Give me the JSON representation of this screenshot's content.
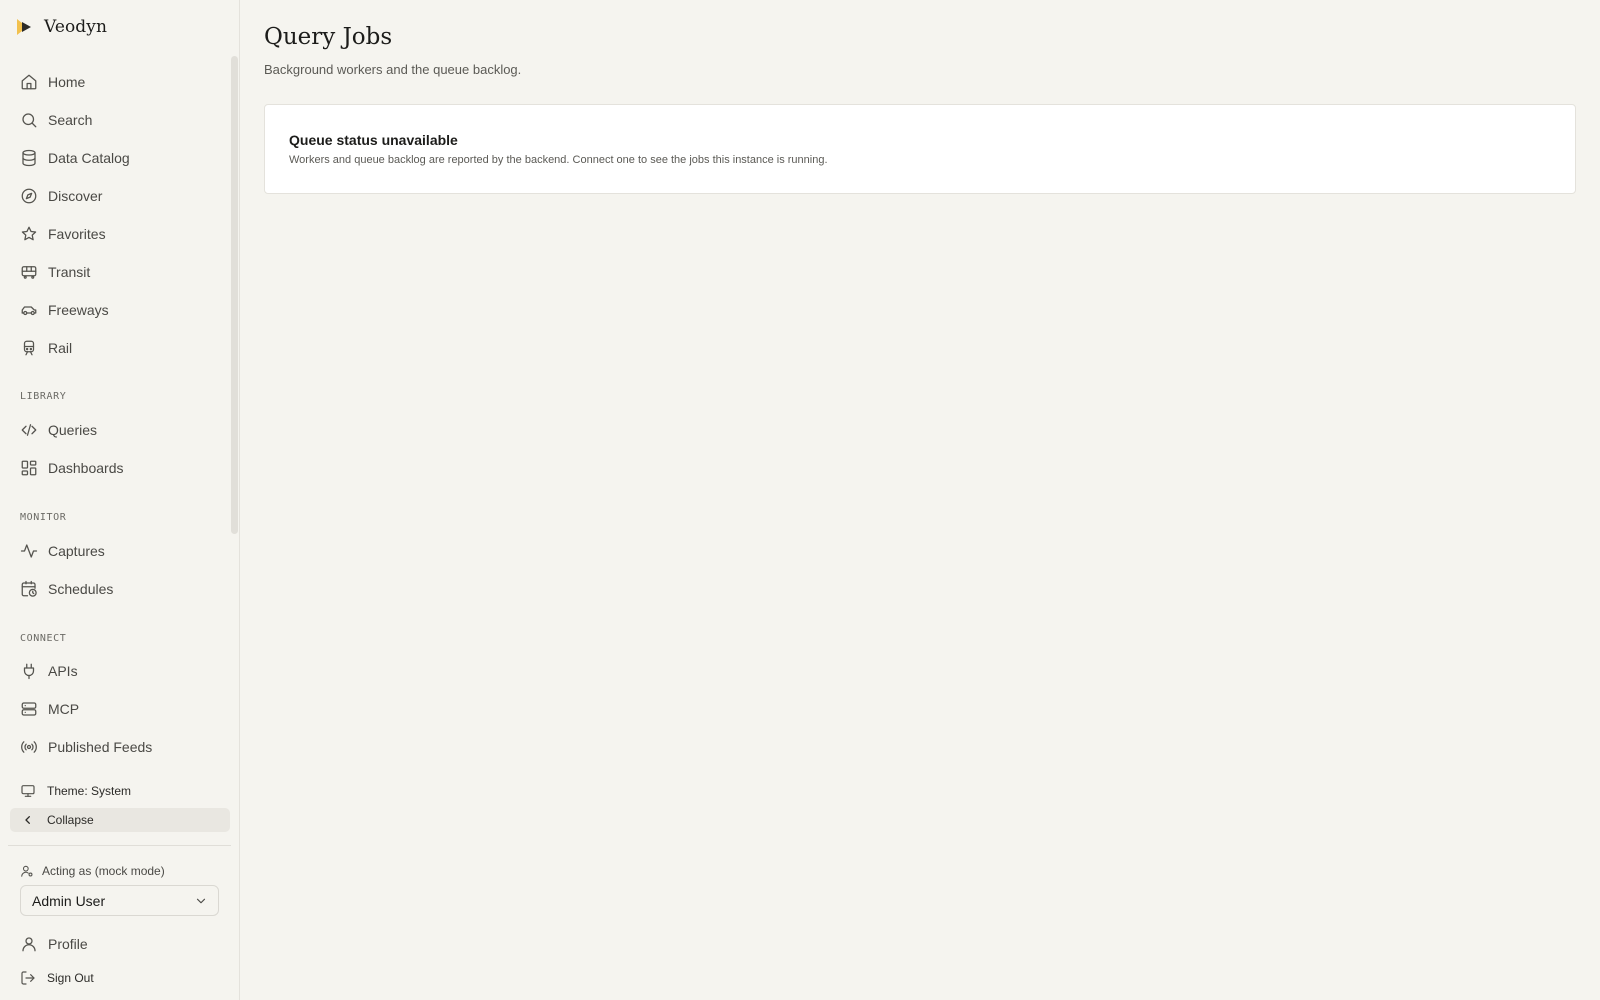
{
  "brand": {
    "name": "Veodyn",
    "logo_colors": [
      "#f2c14e",
      "#2c2b28"
    ]
  },
  "nav": {
    "primary": [
      {
        "label": "Home",
        "icon": "home-icon"
      },
      {
        "label": "Search",
        "icon": "search-icon"
      },
      {
        "label": "Data Catalog",
        "icon": "database-icon"
      },
      {
        "label": "Discover",
        "icon": "compass-icon"
      },
      {
        "label": "Favorites",
        "icon": "star-icon"
      },
      {
        "label": "Transit",
        "icon": "bus-icon"
      },
      {
        "label": "Freeways",
        "icon": "car-icon"
      },
      {
        "label": "Rail",
        "icon": "train-icon"
      }
    ],
    "library": {
      "heading": "LIBRARY",
      "items": [
        {
          "label": "Queries",
          "icon": "code-icon"
        },
        {
          "label": "Dashboards",
          "icon": "dashboard-icon"
        }
      ]
    },
    "monitor": {
      "heading": "MONITOR",
      "items": [
        {
          "label": "Captures",
          "icon": "activity-icon"
        },
        {
          "label": "Schedules",
          "icon": "calendar-clock-icon"
        }
      ]
    },
    "connect": {
      "heading": "CONNECT",
      "items": [
        {
          "label": "APIs",
          "icon": "plug-icon"
        },
        {
          "label": "MCP",
          "icon": "server-icon"
        },
        {
          "label": "Published Feeds",
          "icon": "radio-icon"
        }
      ]
    }
  },
  "footer": {
    "theme_label": "Theme: System",
    "collapse_label": "Collapse",
    "acting_label": "Acting as (mock mode)",
    "selected_user": "Admin User",
    "profile_label": "Profile",
    "signout_label": "Sign Out"
  },
  "page": {
    "title": "Query Jobs",
    "subtitle": "Background workers and the queue backlog."
  },
  "notice": {
    "title": "Queue status unavailable",
    "body": "Workers and queue backlog are reported by the backend. Connect one to see the jobs this instance is running."
  }
}
